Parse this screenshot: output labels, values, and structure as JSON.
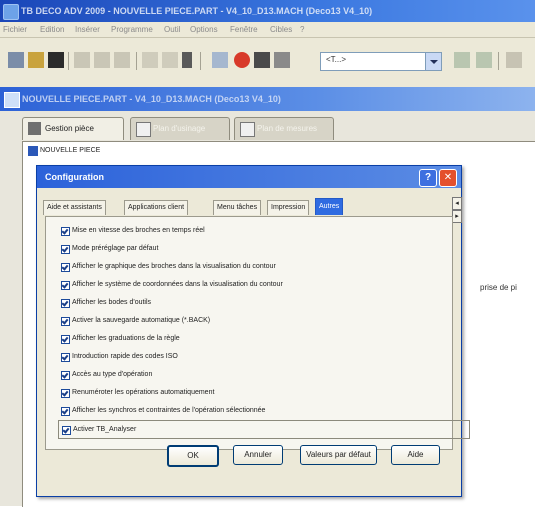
{
  "window": {
    "title": "TB DECO ADV 2009 - NOUVELLE PIECE.PART - V4_10_D13.MACH (Deco13 V4_10)",
    "menu": [
      "Fichier",
      "Edition",
      "Insérer",
      "Programme",
      "Outil",
      "Options",
      "Fenêtre",
      "Cibles",
      "?"
    ]
  },
  "toolbar": {
    "combo_value": "<T...>"
  },
  "document": {
    "title": "NOUVELLE PIECE.PART - V4_10_D13.MACH (Deco13 V4_10)",
    "tabs": [
      "Gestion pièce",
      "Plan d'usinage",
      "Plan de mesures"
    ],
    "tree_root": "NOUVELLE PIECE",
    "side_text": "prise de pi"
  },
  "dialog": {
    "title": "Configuration",
    "tabs": [
      "Aide et assistants",
      "Applications client",
      "Menu tâches",
      "Impression",
      "Autres"
    ],
    "active_tab": "Autres",
    "tab_scroll": [
      "◂",
      "▸"
    ],
    "options": [
      {
        "label": "Mise en vitesse des broches en temps réel",
        "checked": true
      },
      {
        "label": "Mode préréglage par défaut",
        "checked": true
      },
      {
        "label": "Afficher le graphique des broches dans la visualisation du contour",
        "checked": true
      },
      {
        "label": "Afficher le système de coordonnées dans la visualisation du contour",
        "checked": true
      },
      {
        "label": "Afficher les bodes d'outils",
        "checked": true
      },
      {
        "label": "Activer la sauvegarde automatique (*.BACK)",
        "checked": true
      },
      {
        "label": "Afficher les graduations de la règle",
        "checked": true
      },
      {
        "label": "Introduction rapide des codes ISO",
        "checked": true
      },
      {
        "label": "Accès au type d'opération",
        "checked": true
      },
      {
        "label": "Renuméroter les opérations automatiquement",
        "checked": true
      },
      {
        "label": "Afficher les synchros et contraintes de l'opération sélectionnée",
        "checked": true
      },
      {
        "label": "Activer TB_Analyser",
        "checked": true
      }
    ],
    "buttons": {
      "ok": "OK",
      "cancel": "Annuler",
      "defaults": "Valeurs par défaut",
      "help": "Aide"
    },
    "title_help": "?",
    "title_close": "✕"
  }
}
